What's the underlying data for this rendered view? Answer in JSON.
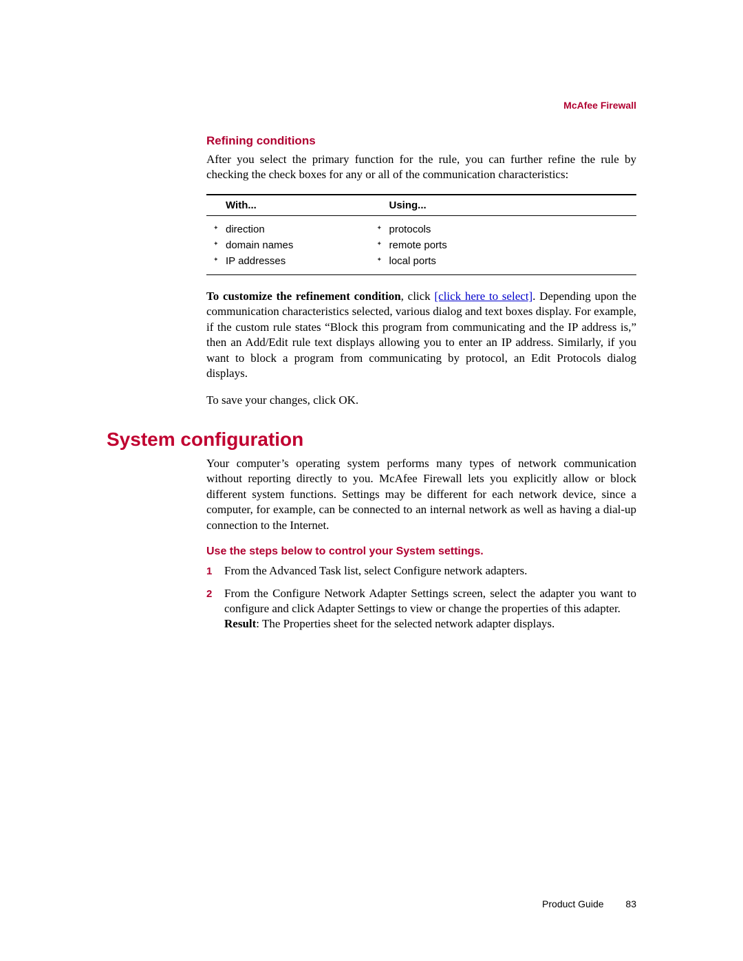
{
  "header": {
    "label": "McAfee Firewall"
  },
  "refining": {
    "heading": "Refining conditions",
    "intro": "After you select the primary function for the rule, you can further refine the rule by checking the check boxes for any or all of the communication characteristics:"
  },
  "table": {
    "col1_header": "With...",
    "col2_header": "Using...",
    "col1_items": [
      "direction",
      "domain names",
      "IP addresses"
    ],
    "col2_items": [
      "protocols",
      "remote ports",
      "local ports"
    ]
  },
  "customize": {
    "bold_lead": "To customize the refinement condition",
    "mid1": ", click ",
    "link_text": "[click here to select]",
    "tail": ". Depending upon the communication characteristics selected, various dialog and text boxes display. For example, if the custom rule states “Block this program from communicating and the IP address is,” then an Add/Edit rule text displays allowing you to enter an IP address. Similarly, if you want to block a program from communicating by protocol, an Edit Protocols dialog displays."
  },
  "save_line": "To save your changes, click OK.",
  "sysconfig": {
    "heading": "System configuration",
    "intro": "Your computer’s operating system performs many types of network communication without reporting directly to you. McAfee Firewall lets you explicitly allow or block different system functions. Settings may be different for each network device, since a computer, for example, can be connected to an internal network as well as having a dial-up connection to the Internet.",
    "steps_heading": "Use the steps below to control your System settings.",
    "steps": [
      {
        "num": "1",
        "text": "From the Advanced Task list, select Configure network adapters."
      },
      {
        "num": "2",
        "text_a": "From the Configure Network Adapter Settings screen, select the adapter you want to configure and click Adapter Settings to view or change the properties of this adapter.",
        "result_label": "Result",
        "result_text": ": The Properties sheet for the selected network adapter displays."
      }
    ]
  },
  "footer": {
    "label": "Product Guide",
    "page": "83"
  }
}
